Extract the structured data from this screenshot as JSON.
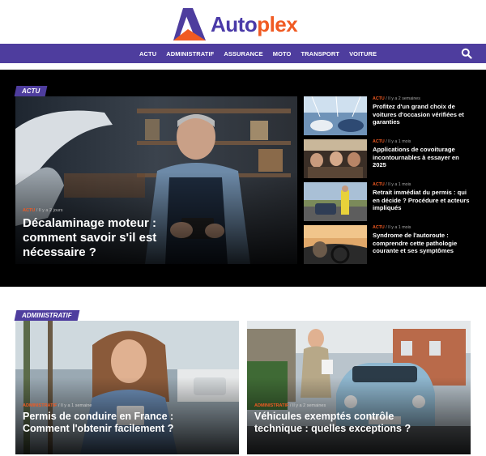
{
  "brand": {
    "name_part1": "Auto",
    "name_part2": "plex"
  },
  "nav": {
    "items": [
      "ACTU",
      "ADMINISTRATIF",
      "ASSURANCE",
      "MOTO",
      "TRANSPORT",
      "VOITURE"
    ],
    "search_icon": "search-icon"
  },
  "colors": {
    "brand_purple": "#4e3d9e",
    "brand_orange": "#f05a22",
    "dark_bg": "#000000"
  },
  "actu": {
    "tag": "ACTU",
    "hero": {
      "category": "ACTU",
      "time": "Il y a 2 jours",
      "title": "Décalaminage moteur : comment savoir s'il est nécessaire ?"
    },
    "side": [
      {
        "category": "ACTU",
        "time": "Il y a 2 semaines",
        "title": "Profitez d'un grand choix de voitures d'occasion vérifiées et garanties"
      },
      {
        "category": "ACTU",
        "time": "Il y a 1 mois",
        "title": "Applications de covoiturage incontournables à essayer en 2025"
      },
      {
        "category": "ACTU",
        "time": "Il y a 1 mois",
        "title": "Retrait immédiat du permis : qui en décide ? Procédure et acteurs impliqués"
      },
      {
        "category": "ACTU",
        "time": "Il y a 1 mois",
        "title": "Syndrome de l'autoroute : comprendre cette pathologie courante et ses symptômes"
      }
    ]
  },
  "administratif": {
    "tag": "ADMINISTRATIF",
    "cards": [
      {
        "category": "ADMINISTRATIF",
        "time": "Il y a 1 semaine",
        "title": "Permis de conduire en France : Comment l'obtenir facilement ?"
      },
      {
        "category": "ADMINISTRATIF",
        "time": "Il y a 2 semaines",
        "title": "Véhicules exemptés contrôle technique : quelles exceptions ?"
      }
    ]
  }
}
